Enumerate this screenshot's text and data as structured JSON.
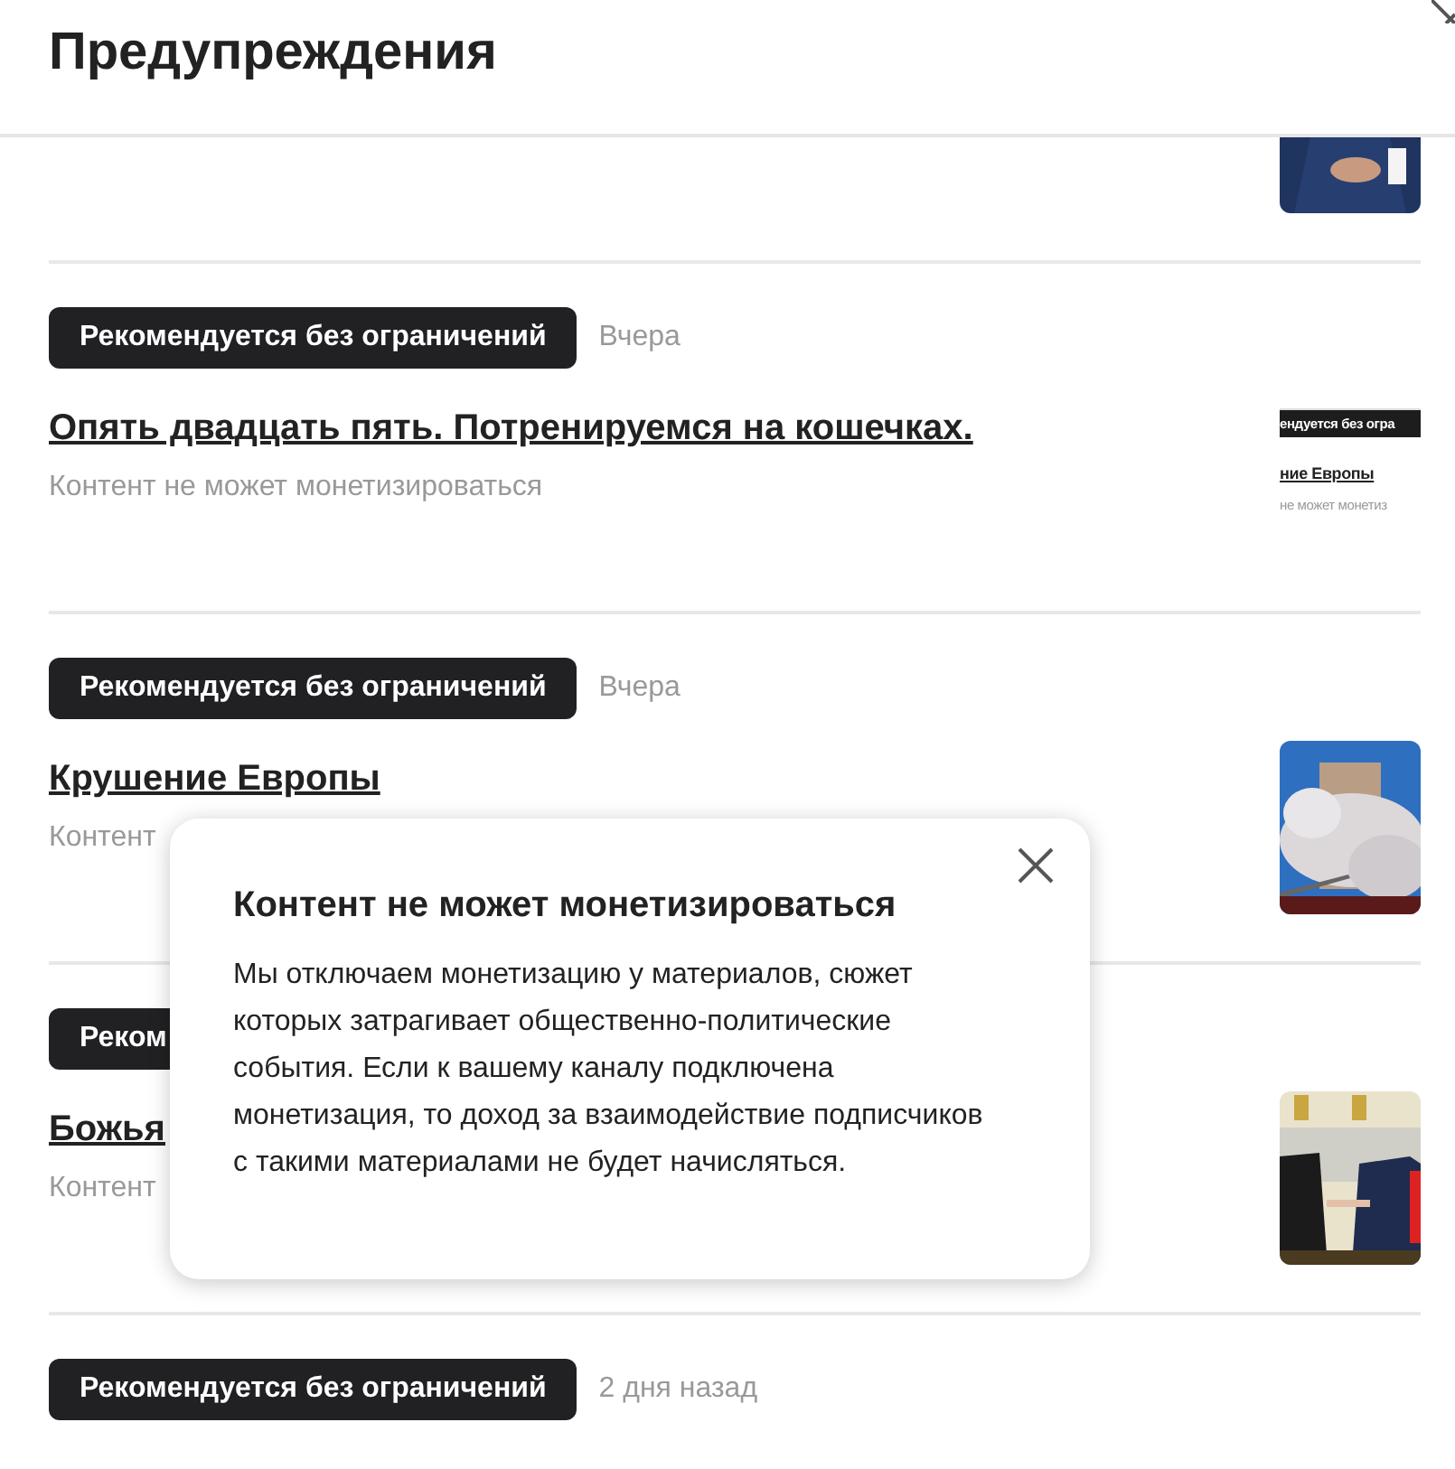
{
  "header": {
    "title": "Предупреждения"
  },
  "items": [
    {
      "thumbnail": {
        "kind": "picture"
      }
    },
    {
      "badge": "Рекомендуется без ограничений",
      "date": "Вчера",
      "title": "Опять двадцать пять. Потренируемся на кошечках.",
      "subtitle": "Контент не может монетизироваться",
      "thumbnail": {
        "kind": "screenshot",
        "lines": [
          "ендуется без огра",
          "ние Европы",
          "не может монетиз"
        ]
      }
    },
    {
      "badge": "Рекомендуется без ограничений",
      "date": "Вчера",
      "title": "Крушение Европы",
      "subtitle": "Контент",
      "thumbnail": {
        "kind": "picture"
      }
    },
    {
      "badge": "Реком",
      "title": "Божья",
      "subtitle": "Контент",
      "thumbnail": {
        "kind": "picture"
      }
    },
    {
      "badge": "Рекомендуется без ограничений",
      "date": "2 дня назад"
    }
  ],
  "popover": {
    "title": "Контент не может монетизироваться",
    "text": "Мы отключаем монетизацию у материалов, сюжет которых затрагивает общественно-политические события. Если к вашему каналу подключена монетизация, то доход за взаимодействие подписчиков с такими материалами не будет начисляться."
  }
}
